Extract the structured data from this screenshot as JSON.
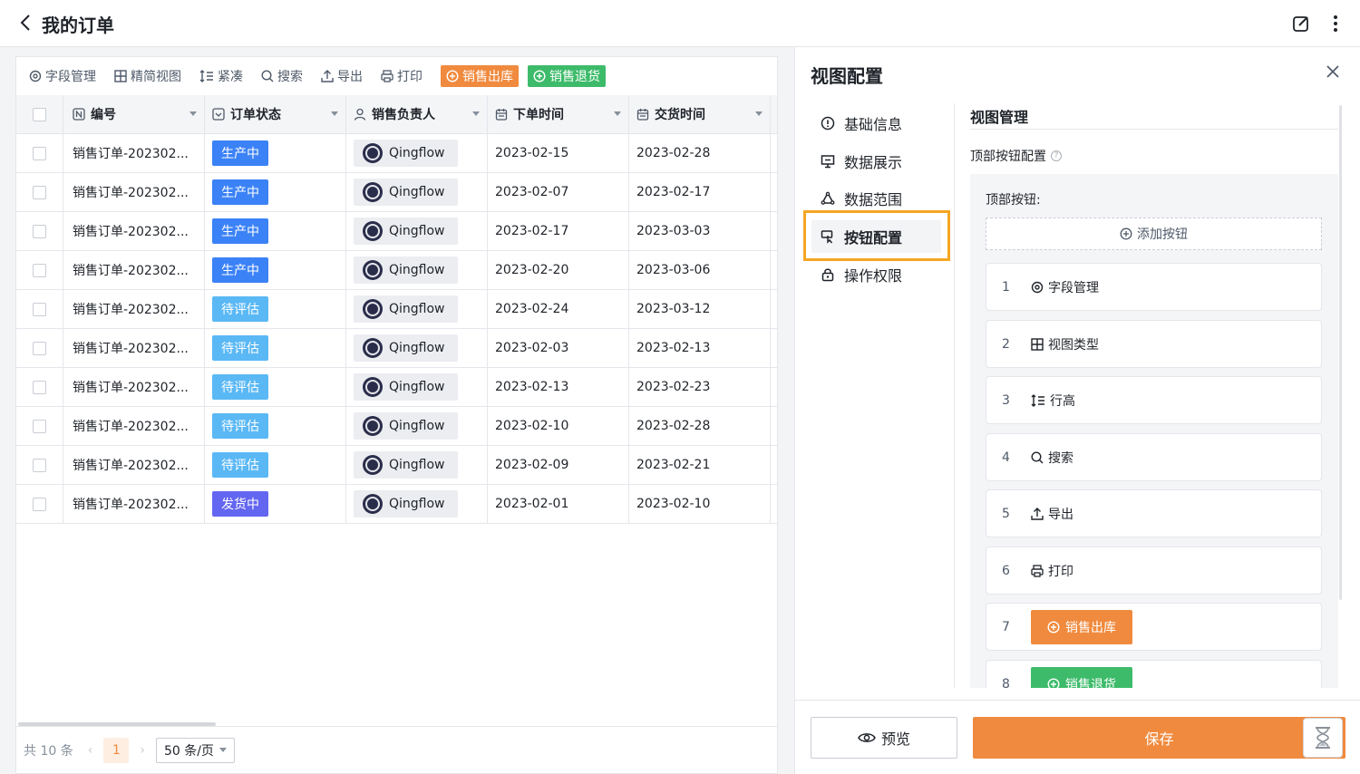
{
  "header": {
    "title": "我的订单"
  },
  "toolbar": {
    "field_manage": "字段管理",
    "simple_view": "精简视图",
    "compact": "紧凑",
    "search": "搜索",
    "export": "导出",
    "print": "打印",
    "sales_out": "销售出库",
    "sales_return": "销售退货"
  },
  "table": {
    "columns": [
      "编号",
      "订单状态",
      "销售负责人",
      "下单时间",
      "交货时间"
    ],
    "rows": [
      {
        "id": "销售订单-202302...",
        "status": "生产中",
        "owner": "Qingflow",
        "order_date": "2023-02-15",
        "delivery_date": "2023-02-28"
      },
      {
        "id": "销售订单-202302...",
        "status": "生产中",
        "owner": "Qingflow",
        "order_date": "2023-02-07",
        "delivery_date": "2023-02-17"
      },
      {
        "id": "销售订单-202302...",
        "status": "生产中",
        "owner": "Qingflow",
        "order_date": "2023-02-17",
        "delivery_date": "2023-03-03"
      },
      {
        "id": "销售订单-202302...",
        "status": "生产中",
        "owner": "Qingflow",
        "order_date": "2023-02-20",
        "delivery_date": "2023-03-06"
      },
      {
        "id": "销售订单-202302...",
        "status": "待评估",
        "owner": "Qingflow",
        "order_date": "2023-02-24",
        "delivery_date": "2023-03-12"
      },
      {
        "id": "销售订单-202302...",
        "status": "待评估",
        "owner": "Qingflow",
        "order_date": "2023-02-03",
        "delivery_date": "2023-02-13"
      },
      {
        "id": "销售订单-202302...",
        "status": "待评估",
        "owner": "Qingflow",
        "order_date": "2023-02-13",
        "delivery_date": "2023-02-23"
      },
      {
        "id": "销售订单-202302...",
        "status": "待评估",
        "owner": "Qingflow",
        "order_date": "2023-02-10",
        "delivery_date": "2023-02-28"
      },
      {
        "id": "销售订单-202302...",
        "status": "待评估",
        "owner": "Qingflow",
        "order_date": "2023-02-09",
        "delivery_date": "2023-02-21"
      },
      {
        "id": "销售订单-202302...",
        "status": "发货中",
        "owner": "Qingflow",
        "order_date": "2023-02-01",
        "delivery_date": "2023-02-10"
      }
    ]
  },
  "pagination": {
    "total": "共 10 条",
    "current": "1",
    "page_size": "50 条/页"
  },
  "panel": {
    "title": "视图配置",
    "menu": [
      "基础信息",
      "数据展示",
      "数据范围",
      "按钮配置",
      "操作权限"
    ],
    "section_title": "视图管理",
    "top_button_config": "顶部按钮配置",
    "top_buttons_label": "顶部按钮:",
    "add_button": "添加按钮",
    "items": [
      {
        "index": "1",
        "label": "字段管理"
      },
      {
        "index": "2",
        "label": "视图类型"
      },
      {
        "index": "3",
        "label": "行高"
      },
      {
        "index": "4",
        "label": "搜索"
      },
      {
        "index": "5",
        "label": "导出"
      },
      {
        "index": "6",
        "label": "打印"
      },
      {
        "index": "7",
        "label": "销售出库"
      },
      {
        "index": "8",
        "label": "销售退货"
      }
    ],
    "preview": "预览",
    "save": "保存"
  },
  "colors": {
    "accent_orange": "#f08a3e",
    "accent_green": "#3dbb6a",
    "status_production": "#3b82f6",
    "status_evaluate": "#5ab8f5",
    "status_shipping": "#6366f1",
    "highlight": "#f5a623"
  }
}
